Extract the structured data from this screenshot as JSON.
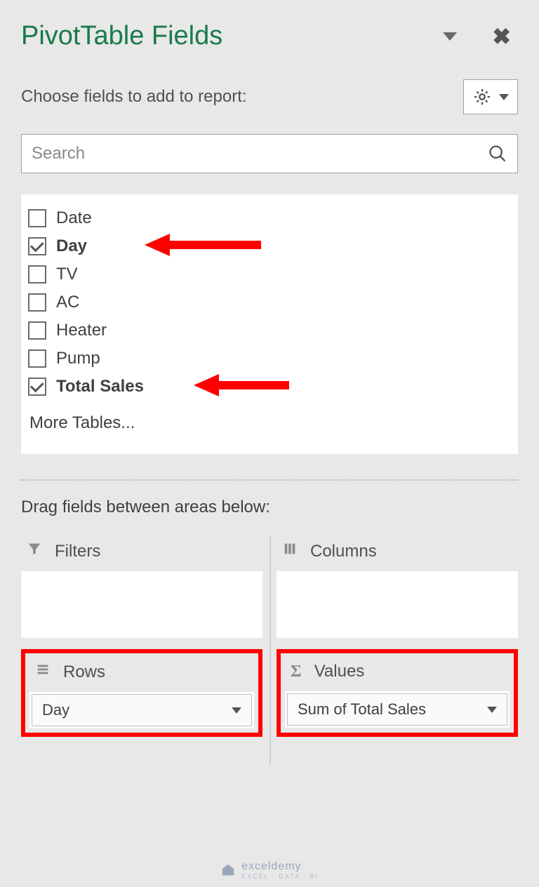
{
  "header": {
    "title": "PivotTable Fields",
    "subtitle": "Choose fields to add to report:"
  },
  "search": {
    "placeholder": "Search"
  },
  "fields": [
    {
      "label": "Date",
      "checked": false
    },
    {
      "label": "Day",
      "checked": true
    },
    {
      "label": "TV",
      "checked": false
    },
    {
      "label": "AC",
      "checked": false
    },
    {
      "label": "Heater",
      "checked": false
    },
    {
      "label": "Pump",
      "checked": false
    },
    {
      "label": "Total Sales",
      "checked": true
    }
  ],
  "more_tables": "More Tables...",
  "drag_label": "Drag fields between areas below:",
  "zones": {
    "filters": {
      "label": "Filters"
    },
    "columns": {
      "label": "Columns"
    },
    "rows": {
      "label": "Rows",
      "item": "Day"
    },
    "values": {
      "label": "Values",
      "item": "Sum of Total Sales"
    }
  },
  "watermark": {
    "brand": "exceldemy",
    "sub": "EXCEL · DATA · BI"
  }
}
